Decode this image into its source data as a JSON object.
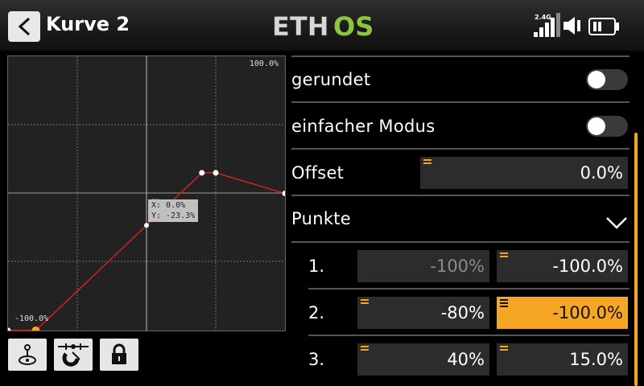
{
  "header": {
    "title": "Kurve 2",
    "logo_text_a": "ETH",
    "logo_text_b": "OS",
    "rf_band": "2.4G"
  },
  "colors": {
    "accent": "#f5a623",
    "logo_green": "#8cc63f",
    "curve": "#d22020"
  },
  "graph": {
    "top_label": "100.0%",
    "bottom_label": "-100.0%",
    "tooltip_hint": "0%",
    "tooltip_x": "X: 0.0%",
    "tooltip_y": "Y: -23.3%"
  },
  "chart_data": {
    "type": "line",
    "x": [
      -100,
      -80,
      40,
      50,
      100
    ],
    "y": [
      -100,
      -100,
      15,
      15,
      0
    ],
    "xlim": [
      -100,
      100
    ],
    "ylim": [
      -100,
      100
    ],
    "grid": true
  },
  "tools": [
    {
      "name": "stick-icon"
    },
    {
      "name": "magnet-snap-icon"
    },
    {
      "name": "lock-icon"
    }
  ],
  "settings": {
    "rounded_label": "gerundet",
    "rounded_on": false,
    "simple_mode_label": "einfacher Modus",
    "simple_mode_on": false,
    "offset_label": "Offset",
    "offset_value": "0.0%",
    "points_label": "Punkte"
  },
  "points": [
    {
      "num": "1.",
      "x": "-100%",
      "y": "-100.0%"
    },
    {
      "num": "2.",
      "x": "-80%",
      "y": "-100.0%"
    },
    {
      "num": "3.",
      "x": "40%",
      "y": "15.0%"
    }
  ]
}
